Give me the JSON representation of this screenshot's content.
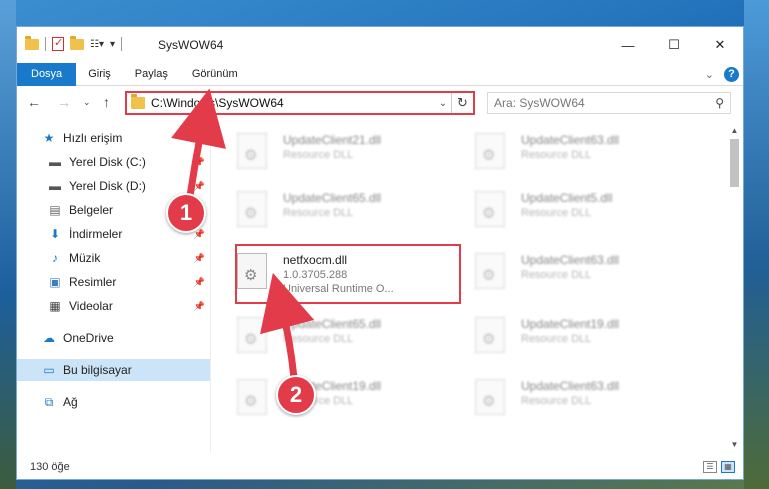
{
  "window": {
    "title": "SysWOW64",
    "controls": {
      "minimize": "—",
      "maximize": "☐",
      "close": "✕"
    }
  },
  "ribbon": {
    "tabs": [
      "Dosya",
      "Giriş",
      "Paylaş",
      "Görünüm"
    ],
    "active_tab": "Dosya"
  },
  "address": {
    "path": "C:\\Windows\\SysWOW64",
    "search_placeholder": "Ara: SysWOW64"
  },
  "sidebar": {
    "quick_access": "Hızlı erişim",
    "items": [
      {
        "label": "Yerel Disk (C:)",
        "icon": "drive-icon"
      },
      {
        "label": "Yerel Disk (D:)",
        "icon": "drive-icon"
      },
      {
        "label": "Belgeler",
        "icon": "document-icon"
      },
      {
        "label": "İndirmeler",
        "icon": "download-icon"
      },
      {
        "label": "Müzik",
        "icon": "music-icon"
      },
      {
        "label": "Resimler",
        "icon": "pictures-icon"
      },
      {
        "label": "Videolar",
        "icon": "video-icon"
      }
    ],
    "onedrive": "OneDrive",
    "this_pc": "Bu bilgisayar",
    "network": "Ağ"
  },
  "files": [
    {
      "name": "UpdateClient21.dll",
      "desc": "Resource DLL",
      "desc2": ""
    },
    {
      "name": "UpdateClient63.dll",
      "desc": "Resource DLL",
      "desc2": ""
    },
    {
      "name": "UpdateClient65.dll",
      "desc": "Resource DLL",
      "desc2": ""
    },
    {
      "name": "UpdateClient5.dll",
      "desc": "Resource DLL",
      "desc2": ""
    },
    {
      "name": "netfxocm.dll",
      "desc": "1.0.3705.288",
      "desc2": "Universal Runtime O..."
    },
    {
      "name": "UpdateClient63.dll",
      "desc": "Resource DLL",
      "desc2": ""
    },
    {
      "name": "UpdateClient65.dll",
      "desc": "Resource DLL",
      "desc2": ""
    },
    {
      "name": "UpdateClient19.dll",
      "desc": "Resource DLL",
      "desc2": ""
    },
    {
      "name": "UpdateClient19.dll",
      "desc": "Resource DLL",
      "desc2": ""
    },
    {
      "name": "UpdateClient63.dll",
      "desc": "Resource DLL",
      "desc2": ""
    }
  ],
  "status": {
    "count": "130 öğe"
  },
  "callouts": {
    "one": "1",
    "two": "2"
  },
  "colors": {
    "accent": "#1979ca",
    "highlight": "#e23b4a"
  }
}
